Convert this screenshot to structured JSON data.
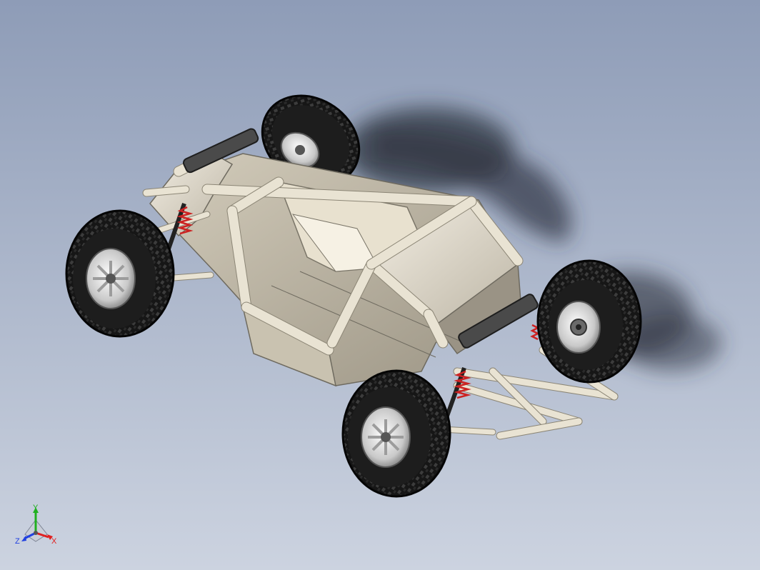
{
  "viewport": {
    "background_top": "#8f9db8",
    "background_bottom": "#cbd2df",
    "shadow_color": "#3a3f4b"
  },
  "model": {
    "frame_color": "#ece6d8",
    "panel_color": "#dcd6c6",
    "tire_color": "#1a1a1a",
    "rim_color": "#d6d6d6",
    "spring_color": "#cc2222",
    "arm_color": "#3a3a3a"
  },
  "triad": {
    "x_label": "X",
    "y_label": "Y",
    "z_label": "Z",
    "x_color": "#e02020",
    "y_color": "#20b020",
    "z_color": "#2040e0"
  }
}
